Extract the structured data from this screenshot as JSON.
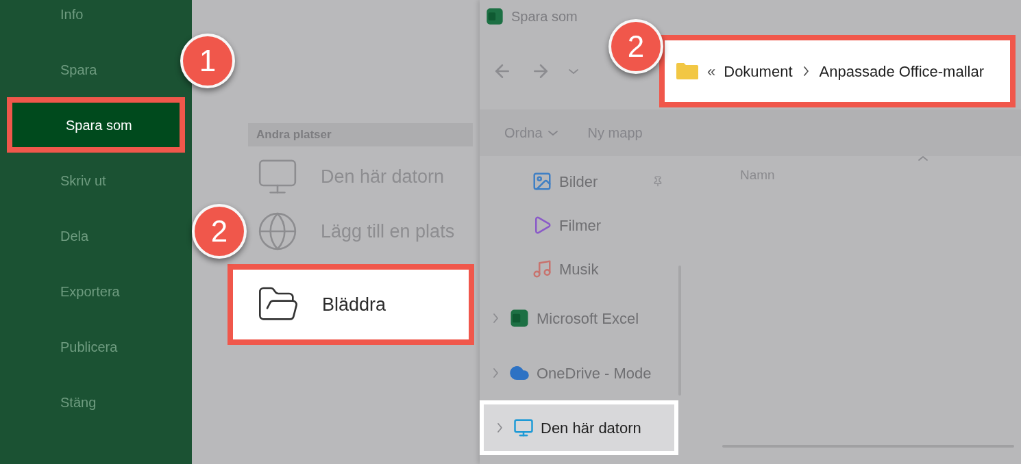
{
  "sidebar": {
    "items": [
      {
        "label": "Info",
        "selected": false
      },
      {
        "label": "Spara",
        "selected": false
      },
      {
        "label": "Spara som",
        "selected": true,
        "highlighted": true,
        "callout": "1"
      },
      {
        "label": "Skriv ut",
        "selected": false
      },
      {
        "label": "Dela",
        "selected": false
      },
      {
        "label": "Exportera",
        "selected": false
      },
      {
        "label": "Publicera",
        "selected": false
      },
      {
        "label": "Stäng",
        "selected": false
      }
    ]
  },
  "places": {
    "heading": "Andra platser",
    "items": [
      {
        "label": "Den här datorn",
        "kind": "computer",
        "highlighted": false
      },
      {
        "label": "Lägg till en plats",
        "kind": "globe",
        "highlighted": false
      },
      {
        "label": "Bläddra",
        "kind": "folder",
        "highlighted": true,
        "callout": "2"
      }
    ]
  },
  "dialog": {
    "title": "Spara som",
    "address": {
      "overflow": "«",
      "parts": [
        "Dokument",
        "Anpassade Office-mallar"
      ],
      "highlighted": true,
      "callout": "2"
    },
    "toolbar": [
      {
        "label": "Ordna",
        "dropdown": true
      },
      {
        "label": "Ny mapp",
        "dropdown": false
      }
    ],
    "nav": [
      {
        "label": "Bilder",
        "kind": "pictures",
        "pinned": true,
        "expandable": false,
        "highlighted": false
      },
      {
        "label": "Filmer",
        "kind": "videos",
        "pinned": false,
        "expandable": false,
        "highlighted": false
      },
      {
        "label": "Musik",
        "kind": "music",
        "pinned": false,
        "expandable": false,
        "highlighted": false
      },
      {
        "label": "Microsoft Excel",
        "kind": "excel",
        "pinned": false,
        "expandable": true,
        "highlighted": false
      },
      {
        "label": "OneDrive - Mode",
        "kind": "cloud",
        "pinned": false,
        "expandable": true,
        "highlighted": false
      },
      {
        "label": "Den här datorn",
        "kind": "computer",
        "pinned": false,
        "expandable": true,
        "highlighted": true
      }
    ],
    "column": "Namn"
  }
}
